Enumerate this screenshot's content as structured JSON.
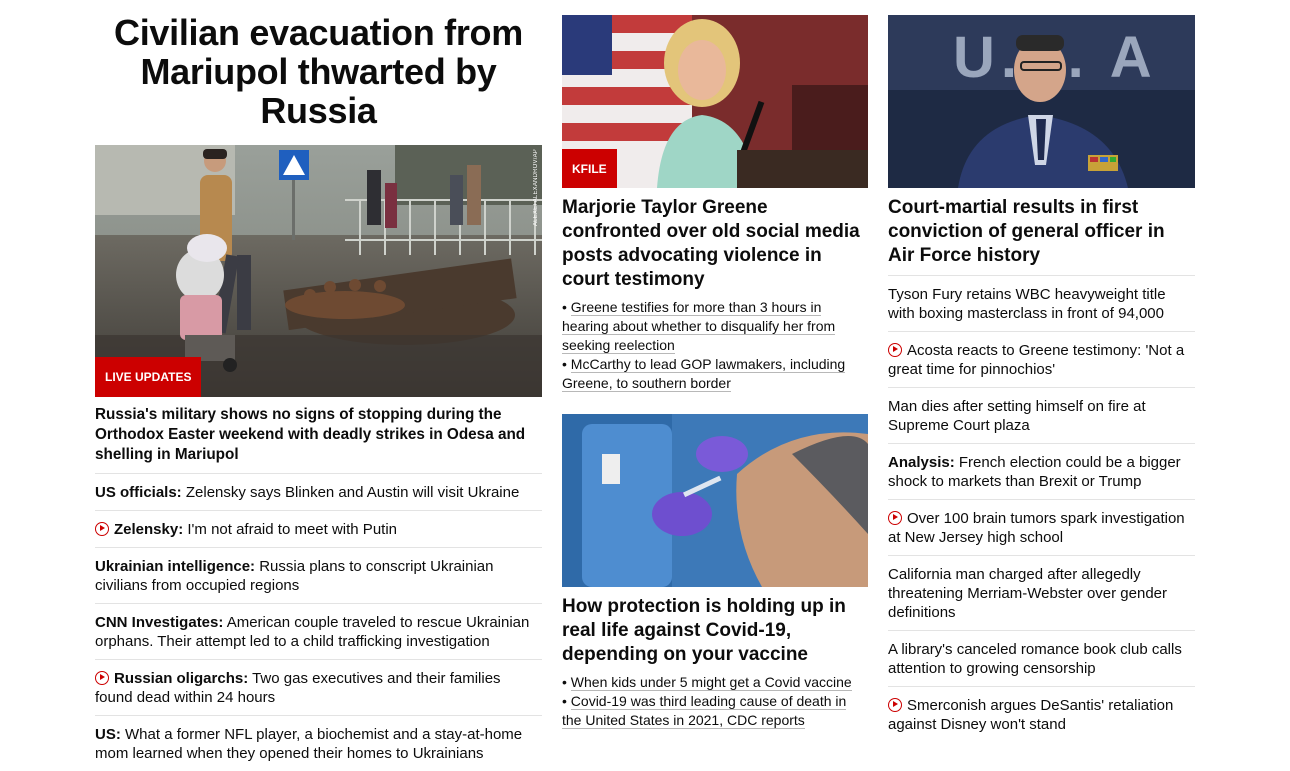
{
  "col1": {
    "headline": "Civilian evacuation from Mariupol thwarted by Russia",
    "image": {
      "alt": "Man pushing a cart of belongings past debris",
      "tag": "LIVE UPDATES",
      "credit": "ALEXEI ALEXANDROV/AP"
    },
    "lead": "Russia's military shows no signs of stopping during the Orthodox Easter weekend with deadly strikes in Odesa and shelling in Mariupol",
    "items": [
      {
        "kicker": "US officials:",
        "text": " Zelensky says Blinken and Austin will visit Ukraine"
      },
      {
        "kicker": "Zelensky:",
        "text": " I'm not afraid to meet with Putin",
        "video": true
      },
      {
        "kicker": "Ukrainian intelligence:",
        "text": " Russia plans to conscript Ukrainian civilians from occupied regions"
      },
      {
        "kicker": "CNN Investigates:",
        "text": " American couple traveled to rescue Ukrainian orphans. Their attempt led to a child trafficking investigation"
      },
      {
        "kicker": "Russian oligarchs:",
        "text": " Two gas executives and their families found dead within 24 hours",
        "video": true
      },
      {
        "kicker": "US:",
        "text": " What a former NFL player, a biochemist and a stay-at-home mom learned when they opened their homes to Ukrainians"
      }
    ]
  },
  "col2": {
    "story1": {
      "tag": "KFILE",
      "headline": "Marjorie Taylor Greene confronted over old social media posts advocating violence in court testimony",
      "bullets": [
        "Greene testifies for more than 3 hours in hearing about whether to disqualify her from seeking reelection",
        "McCarthy to lead GOP lawmakers, including Greene, to southern border"
      ]
    },
    "story2": {
      "headline": "How protection is holding up in real life against Covid-19, depending on your vaccine",
      "bullets": [
        "When kids under 5 might get a Covid vaccine",
        "Covid-19 was third leading cause of death in the United States in 2021, CDC reports"
      ]
    }
  },
  "col3": {
    "headline": "Court-martial results in first conviction of general officer in Air Force history",
    "image": {
      "sign_text": "U.S. A"
    },
    "items": [
      {
        "text": "Tyson Fury retains WBC heavyweight title with boxing masterclass in front of 94,000"
      },
      {
        "text": "Acosta reacts to Greene testimony: 'Not a great time for pinnochios'",
        "video": true
      },
      {
        "text": "Man dies after setting himself on fire at Supreme Court plaza"
      },
      {
        "kicker": "Analysis:",
        "text": " French election could be a bigger shock to markets than Brexit or Trump"
      },
      {
        "text": "Over 100 brain tumors spark investigation at New Jersey high school",
        "video": true
      },
      {
        "text": "California man charged after allegedly threatening Merriam-Webster over gender definitions"
      },
      {
        "text": "A library's canceled romance book club calls attention to growing censorship"
      },
      {
        "text": "Smerconish argues DeSantis' retaliation against Disney won't stand",
        "video": true
      }
    ]
  },
  "colors": {
    "accent": "#cc0000",
    "divider": "#e3e3e3",
    "text": "#0c0c0c"
  }
}
